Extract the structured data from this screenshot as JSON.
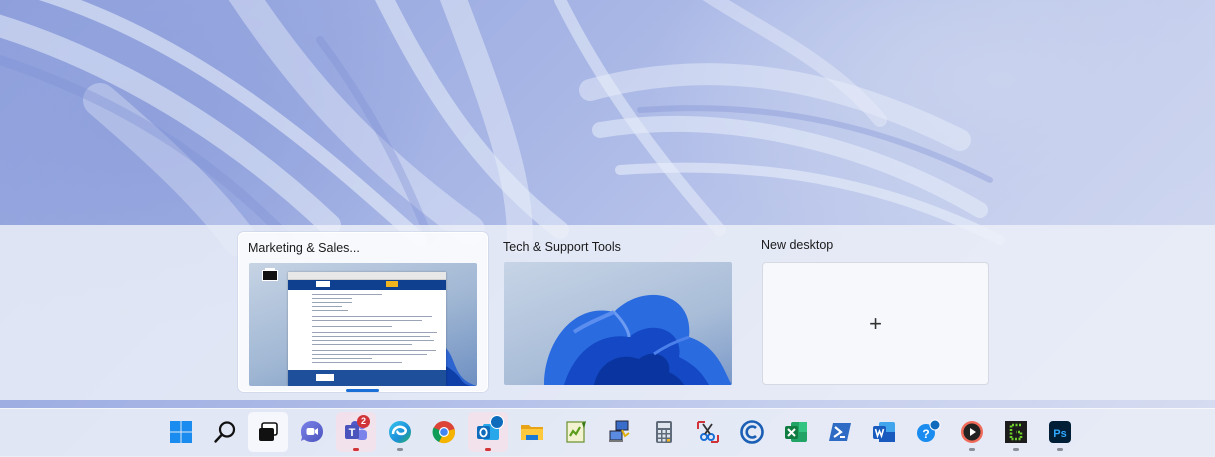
{
  "desktops": [
    {
      "title": "Marketing & Sales...",
      "active": true
    },
    {
      "title": "Tech & Support Tools",
      "active": false
    },
    {
      "title": "New desktop",
      "action": "+"
    }
  ],
  "taskbar": {
    "items": [
      {
        "name": "start",
        "icon": "windows-logo-icon"
      },
      {
        "name": "search",
        "icon": "search-icon"
      },
      {
        "name": "task-view",
        "icon": "task-view-icon"
      },
      {
        "name": "chat",
        "icon": "chat-icon"
      },
      {
        "name": "teams",
        "icon": "teams-icon",
        "badge": "2"
      },
      {
        "name": "edge",
        "icon": "edge-icon"
      },
      {
        "name": "chrome",
        "icon": "chrome-icon"
      },
      {
        "name": "outlook",
        "icon": "outlook-icon"
      },
      {
        "name": "file-explorer",
        "icon": "folder-icon"
      },
      {
        "name": "notepad-plus",
        "icon": "notepad-icon"
      },
      {
        "name": "remote-desktop",
        "icon": "network-icon"
      },
      {
        "name": "calculator",
        "icon": "calculator-icon"
      },
      {
        "name": "snipping-tool",
        "icon": "scissors-icon"
      },
      {
        "name": "ccleaner",
        "icon": "ccleaner-icon"
      },
      {
        "name": "excel",
        "icon": "excel-icon"
      },
      {
        "name": "powershell",
        "icon": "powershell-icon"
      },
      {
        "name": "word",
        "icon": "word-icon"
      },
      {
        "name": "quick-assist",
        "icon": "quick-assist-icon"
      },
      {
        "name": "media-player",
        "icon": "play-icon"
      },
      {
        "name": "greenshot",
        "icon": "greenshot-icon"
      },
      {
        "name": "photoshop",
        "icon": "photoshop-icon"
      }
    ]
  },
  "colors": {
    "accent": "#1a6fd6",
    "notification": "#d13438"
  }
}
